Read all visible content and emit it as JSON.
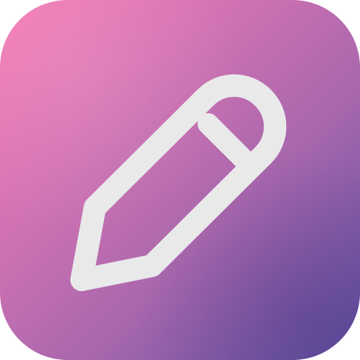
{
  "app_icon": {
    "icon": "pencil-icon",
    "colors": {
      "gradient_start": "#f67cb3",
      "gradient_mid": "#a867ad",
      "gradient_end": "#5d4f9e",
      "glyph": "#e9e9ea"
    }
  }
}
